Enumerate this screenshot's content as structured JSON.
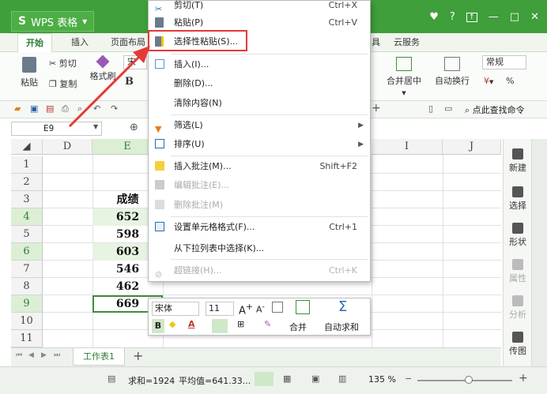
{
  "app": {
    "name": "WPS 表格",
    "logo": "S"
  },
  "window_controls": {
    "skin": "♥",
    "help": "?",
    "minimize": "—",
    "maximize": "□",
    "close": "✕"
  },
  "tabs": [
    {
      "label": "开始"
    },
    {
      "label": "插入"
    },
    {
      "label": "页面布局"
    },
    {
      "label": "具"
    },
    {
      "label": "云服务"
    }
  ],
  "ribbon": {
    "paste": "粘贴",
    "cut": "剪切",
    "copy": "复制",
    "format_painter": "格式刷",
    "font_preview": "宋",
    "bold": "B",
    "merge_center": "合并居中",
    "wrap_text": "自动换行",
    "number_format": "常规",
    "percent": "%",
    "find_command": "点此查找命令"
  },
  "formula_bar": {
    "name_box": "E9"
  },
  "grid": {
    "columns": [
      "D",
      "E",
      "I",
      "J"
    ],
    "rows": [
      "1",
      "2",
      "3",
      "4",
      "5",
      "6",
      "7",
      "8",
      "9",
      "10",
      "11"
    ],
    "cells_E": [
      "",
      "",
      "成绩",
      "652",
      "598",
      "603",
      "546",
      "462",
      "669",
      "",
      ""
    ]
  },
  "context_menu": {
    "items": [
      {
        "label": "剪切(T)",
        "shortcut": "Ctrl+X"
      },
      {
        "label": "粘贴(P)",
        "shortcut": "Ctrl+V"
      },
      {
        "label": "选择性粘贴(S)...",
        "shortcut": ""
      },
      {
        "label": "插入(I)...",
        "shortcut": ""
      },
      {
        "label": "删除(D)...",
        "shortcut": ""
      },
      {
        "label": "清除内容(N)",
        "shortcut": ""
      },
      {
        "label": "筛选(L)",
        "shortcut": ""
      },
      {
        "label": "排序(U)",
        "shortcut": ""
      },
      {
        "label": "插入批注(M)...",
        "shortcut": "Shift+F2"
      },
      {
        "label": "编辑批注(E)...",
        "shortcut": ""
      },
      {
        "label": "删除批注(M)",
        "shortcut": ""
      },
      {
        "label": "设置单元格格式(F)...",
        "shortcut": "Ctrl+1"
      },
      {
        "label": "从下拉列表中选择(K)...",
        "shortcut": ""
      },
      {
        "label": "超链接(H)...",
        "shortcut": "Ctrl+K"
      }
    ]
  },
  "mini_toolbar": {
    "font_name": "宋体",
    "font_size": "11",
    "merge": "合并",
    "autosum": "自动求和"
  },
  "side_panel": {
    "items": [
      {
        "label": "新建"
      },
      {
        "label": "选择"
      },
      {
        "label": "形状"
      },
      {
        "label": "属性"
      },
      {
        "label": "分析"
      },
      {
        "label": "传图"
      }
    ]
  },
  "sheet_tabs": [
    "工作表1"
  ],
  "status": {
    "sum": "求和=1924",
    "average": "平均值=641.33...",
    "zoom": "135 %"
  },
  "colors": {
    "accent": "#3f9f3a",
    "highlight_box": "#e53935",
    "selection_fill": "#e7f4e2"
  }
}
